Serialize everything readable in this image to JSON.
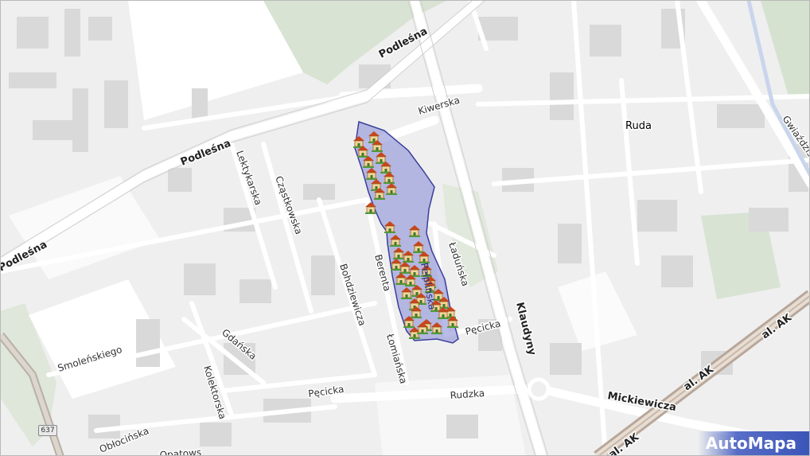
{
  "map": {
    "district_label": "Ruda",
    "streets": {
      "podlesna": "Podleśna",
      "kiwerska": "Kiwerska",
      "lektykarska": "Lektykarska",
      "czastkowska": "Cząstkowska",
      "bohdziewicza": "Bohdziewicza",
      "berenta": "Berenta",
      "pelplinska": "Pelplińska",
      "ladunska": "Ładuńska",
      "smolenskiego": "Smoleńskiego",
      "gdanska": "Gdańska",
      "kolektorska": "Kolektorska",
      "lomianska": "Łomiańska",
      "pecicka": "Pęcicka",
      "rudzka": "Rudzka",
      "klaudyny": "Klaudyny",
      "mickiewicza": "Mickiewicza",
      "al_ak": "al. AK",
      "gwiazdzista": "Gwiaździsta",
      "oblocinska": "Obłocińska",
      "opatowska": "Opatows"
    },
    "road_badge": "637",
    "logo_text": "AutoMapa",
    "highlight_color": "#8a8fd6",
    "house_marker_count": 44
  }
}
